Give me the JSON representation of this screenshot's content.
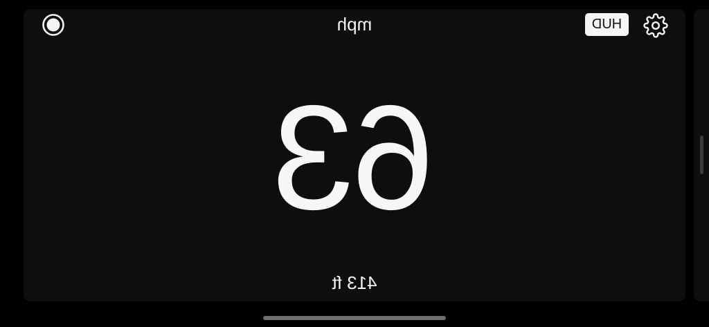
{
  "header": {
    "unit_label": "mph",
    "hud_label": "HUD"
  },
  "main": {
    "speed_value": "63",
    "altitude_label": "413 ft"
  },
  "icons": {
    "record": "record-icon",
    "settings": "gear-icon"
  },
  "colors": {
    "background": "#000000",
    "card": "#0e0e0e",
    "text": "#f5f5f5",
    "hud_button_bg": "#f5f5f5",
    "hud_button_text": "#111111"
  }
}
